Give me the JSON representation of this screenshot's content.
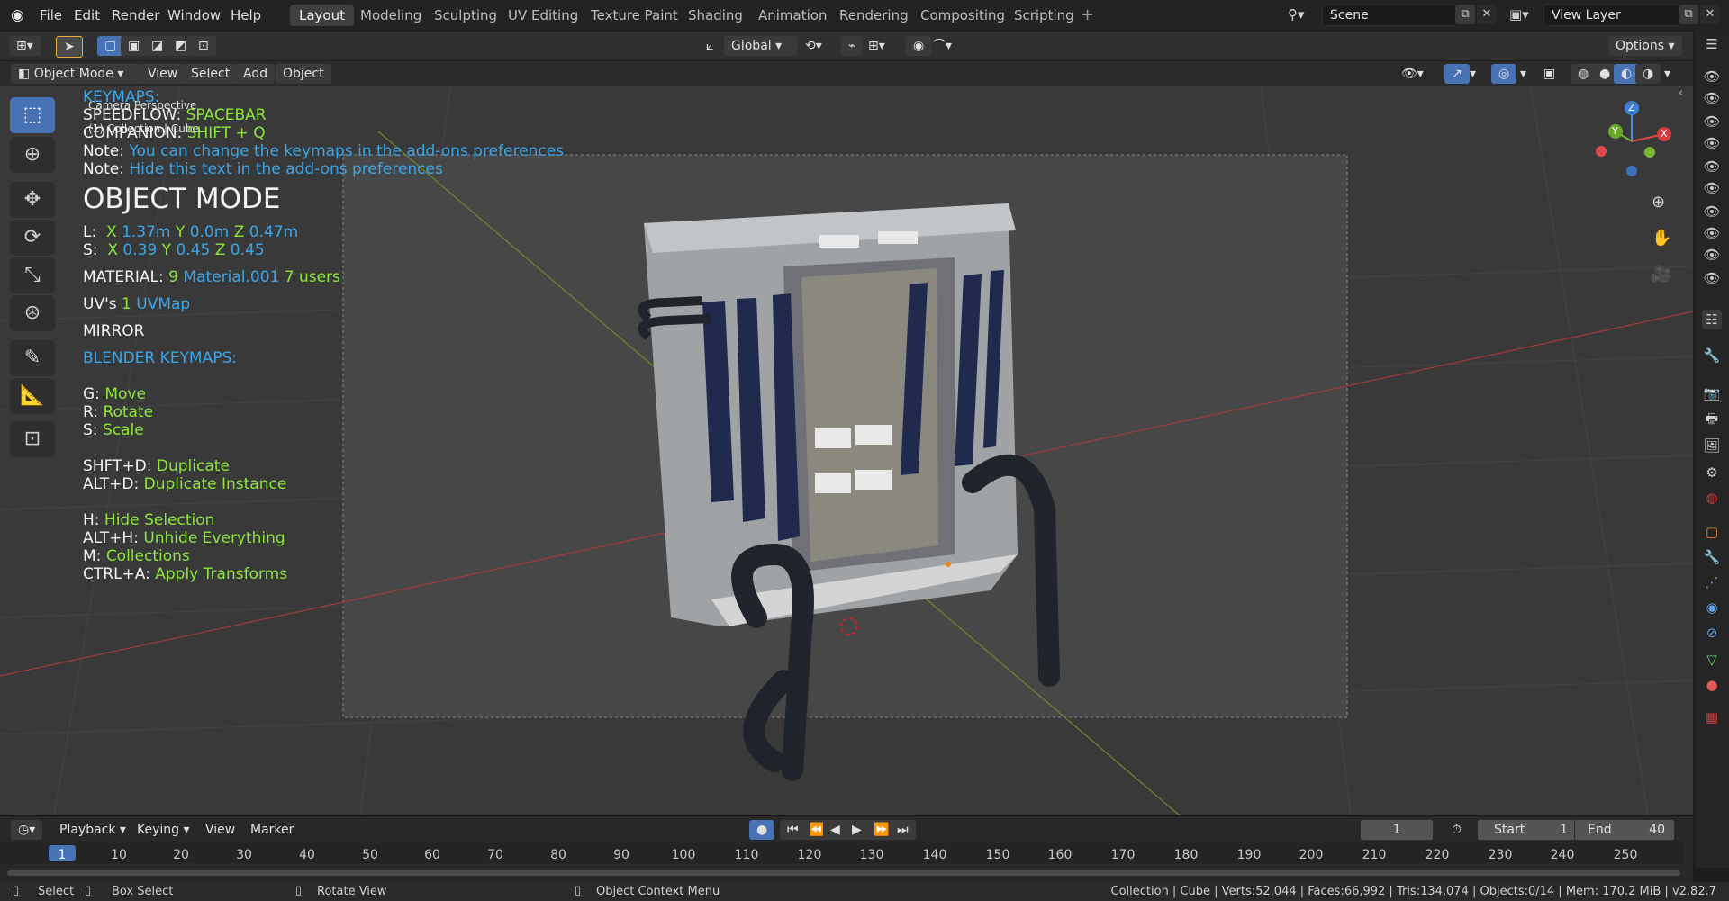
{
  "menu": [
    "File",
    "Edit",
    "Render",
    "Window",
    "Help"
  ],
  "workspaces": [
    {
      "label": "Layout",
      "active": true
    },
    {
      "label": "Modeling"
    },
    {
      "label": "Sculpting"
    },
    {
      "label": "UV Editing"
    },
    {
      "label": "Texture Paint"
    },
    {
      "label": "Shading"
    },
    {
      "label": "Animation"
    },
    {
      "label": "Rendering"
    },
    {
      "label": "Compositing"
    },
    {
      "label": "Scripting"
    }
  ],
  "scene": {
    "label": "Scene"
  },
  "view_layer": {
    "label": "View Layer"
  },
  "toolheader": {
    "transform": "Global",
    "options": "Options"
  },
  "vpheader": {
    "mode": "Object Mode",
    "view": "View",
    "select": "Select",
    "add": "Add",
    "object": "Object"
  },
  "viewport_info": {
    "line1": "Camera Perspective",
    "line2": "(1) Collection | Cube"
  },
  "overlay": {
    "keymaps_title": "KEYMAPS:",
    "speedflow_label": "SPEEDFLOW:",
    "speedflow_key": "SPACEBAR",
    "companion_label": "COMPANION:",
    "companion_key": "SHIFT + Q",
    "note1_label": "Note:",
    "note1_text": "You can change the keymaps in the add-ons preferences",
    "note2_label": "Note:",
    "note2_text": "Hide this text in the add-ons preferences",
    "mode_title": "OBJECT MODE",
    "loc_label": "L:",
    "loc_x_label": "X",
    "loc_x": "1.37m",
    "loc_y_label": "Y",
    "loc_y": "0.0m",
    "loc_z_label": "Z",
    "loc_z": "0.47m",
    "scale_label": "S:",
    "scale_x_label": "X",
    "scale_x": "0.39",
    "scale_y_label": "Y",
    "scale_y": "0.45",
    "scale_z_label": "Z",
    "scale_z": "0.45",
    "material_label": "MATERIAL:",
    "material_count": "9",
    "material_name": "Material.001",
    "material_users": "7 users",
    "uv_label": "UV's",
    "uv_count": "1",
    "uv_name": "UVMap",
    "mirror": "MIRROR",
    "blender_keymaps": "BLENDER KEYMAPS:",
    "g_label": "G:",
    "g_action": "Move",
    "r_label": "R:",
    "r_action": "Rotate",
    "s_label": "S:",
    "s_action": "Scale",
    "shd_label": "SHFT+D:",
    "shd_action": "Duplicate",
    "ald_label": "ALT+D:",
    "ald_action": "Duplicate Instance",
    "h_label": "H:",
    "h_action": "Hide Selection",
    "alh_label": "ALT+H:",
    "alh_action": "Unhide Everything",
    "m_label": "M:",
    "m_action": "Collections",
    "cta_label": "CTRL+A:",
    "cta_action": "Apply Transforms"
  },
  "gizmo": {
    "x": "X",
    "y": "Y",
    "z": "Z"
  },
  "timeline": {
    "playback": "Playback",
    "keying": "Keying",
    "view": "View",
    "marker": "Marker",
    "current_frame": "1",
    "start_label": "Start",
    "start": "1",
    "end_label": "End",
    "end": "40",
    "ruler": [
      "1",
      "10",
      "20",
      "30",
      "40",
      "50",
      "60",
      "70",
      "80",
      "90",
      "100",
      "110",
      "120",
      "130",
      "140",
      "150",
      "160",
      "170",
      "180",
      "190",
      "200",
      "210",
      "220",
      "230",
      "240",
      "250"
    ]
  },
  "status": {
    "select": "Select",
    "box_select": "Box Select",
    "rotate_view": "Rotate View",
    "context_menu": "Object Context Menu",
    "stats": "Collection | Cube | Verts:52,044 | Faces:66,992 | Tris:134,074 | Objects:0/14 | Mem: 170.2 MiB | v2.82.7"
  },
  "colors": {
    "accent": "#4772b3",
    "overlay_blue": "#3aa6e8",
    "overlay_green": "#8be63b"
  }
}
